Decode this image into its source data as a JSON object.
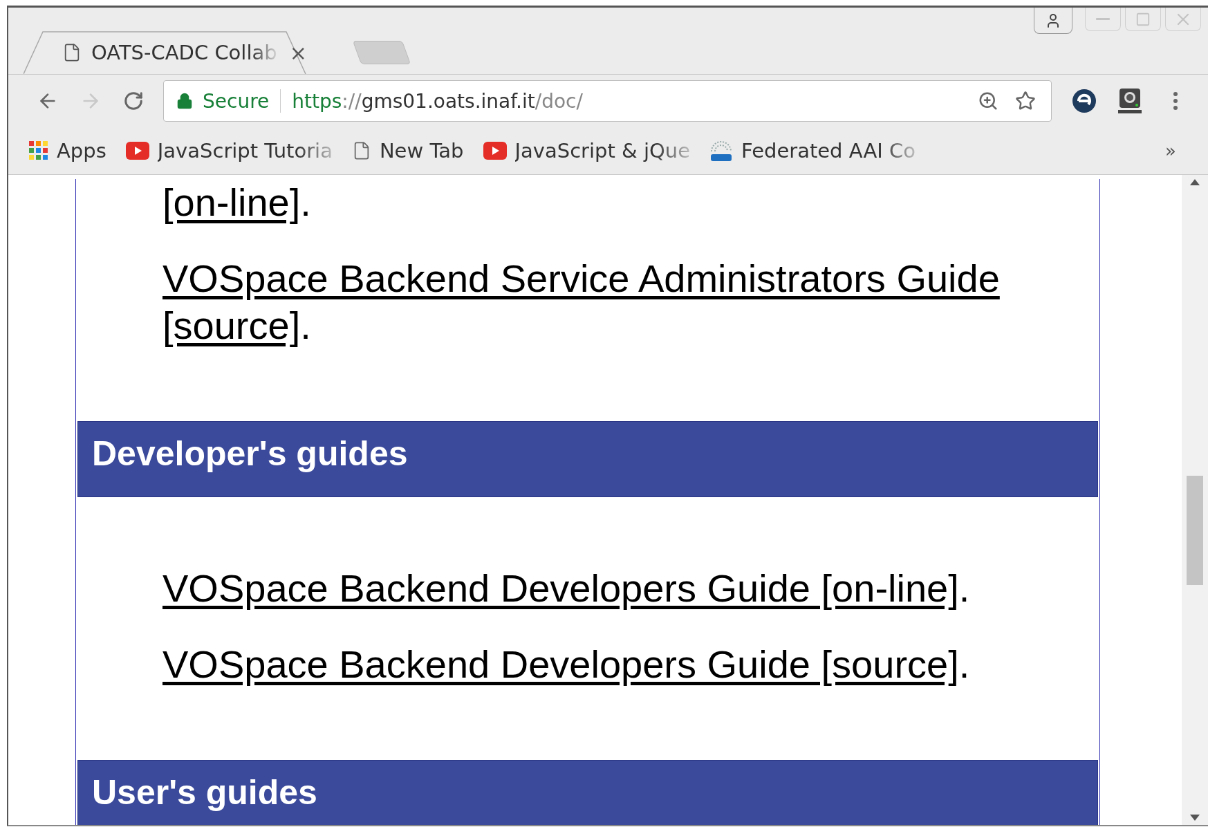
{
  "tabs": [
    {
      "title": "OATS-CADC Collab",
      "close": "×",
      "selected": true
    }
  ],
  "nav_buttons": [
    {
      "kind": "back",
      "disabled": false
    },
    {
      "kind": "forward",
      "disabled": true
    },
    {
      "kind": "reload",
      "disabled": false
    }
  ],
  "address_bar": {
    "security": "Secure",
    "scheme": "https",
    "separator": "://",
    "host": "gms01.oats.inaf.it",
    "path": "/doc/"
  },
  "bookmarks": [
    {
      "kind": "apps",
      "label": "Apps",
      "faded": false
    },
    {
      "kind": "video",
      "label": "JavaScript Tutoria",
      "faded": true
    },
    {
      "kind": "page",
      "label": "New Tab",
      "faded": false
    },
    {
      "kind": "video",
      "label": "JavaScript & jQue",
      "faded": true
    },
    {
      "kind": "egi",
      "label": "Federated AAI Co",
      "faded": true
    }
  ],
  "bookmarks_overflow": "»",
  "page": [
    {
      "kind": "entry",
      "links": [
        "[on-line]"
      ],
      "end": "."
    },
    {
      "kind": "entry",
      "links": [
        "VOSpace Backend Service Administrators Guide",
        "[source]"
      ],
      "end": "."
    },
    {
      "kind": "heading",
      "text": "Developer's guides"
    },
    {
      "kind": "entry",
      "links": [
        "VOSpace Backend Developers Guide [on-line]"
      ],
      "end": "."
    },
    {
      "kind": "entry",
      "links": [
        "VOSpace Backend Developers Guide [source]"
      ],
      "end": "."
    },
    {
      "kind": "heading",
      "text": "User's guides"
    }
  ]
}
